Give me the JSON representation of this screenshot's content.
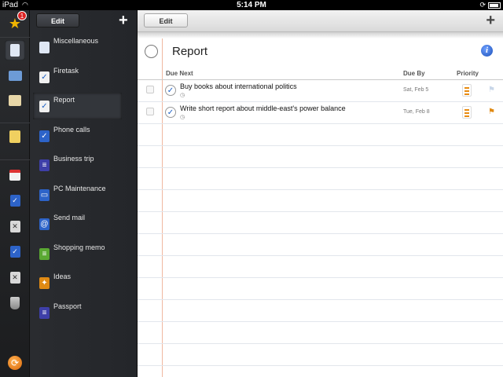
{
  "statusbar": {
    "device": "iPad",
    "time": "5:14 PM"
  },
  "rail": {
    "badge_count": "1"
  },
  "lists": {
    "edit_label": "Edit",
    "add_label": "+",
    "items": [
      {
        "label": "Miscellaneous",
        "icon": "notepad-icon",
        "color": "#dfe7f4"
      },
      {
        "label": "Firetask",
        "icon": "checklist-icon",
        "color": "#f0f0f0"
      },
      {
        "label": "Report",
        "icon": "checklist-icon",
        "color": "#f0f0f0"
      },
      {
        "label": "Phone calls",
        "icon": "phone-list-icon",
        "color": "#2d63c8"
      },
      {
        "label": "Business trip",
        "icon": "trip-list-icon",
        "color": "#3e3fa8"
      },
      {
        "label": "PC Maintenance",
        "icon": "pc-list-icon",
        "color": "#2d63c8"
      },
      {
        "label": "Send mail",
        "icon": "mail-list-icon",
        "color": "#2d63c8"
      },
      {
        "label": "Shopping memo",
        "icon": "shopping-list-icon",
        "color": "#5aa832"
      },
      {
        "label": "Ideas",
        "icon": "ideas-list-icon",
        "color": "#e08a14"
      },
      {
        "label": "Passport",
        "icon": "passport-list-icon",
        "color": "#3e3fa8"
      }
    ]
  },
  "main": {
    "edit_label": "Edit",
    "add_label": "+",
    "title": "Report",
    "info_label": "i",
    "columns": {
      "due_next": "Due Next",
      "due_by": "Due By",
      "priority": "Priority"
    },
    "tasks": [
      {
        "title": "Buy books about international politics",
        "clock": "◷",
        "due": "Sat, Feb 5",
        "flag_color": "#c8d6e8"
      },
      {
        "title": "Write short report about middle-east's power balance",
        "clock": "◷",
        "due": "Tue, Feb 8",
        "flag_color": "#e08a14"
      }
    ]
  }
}
